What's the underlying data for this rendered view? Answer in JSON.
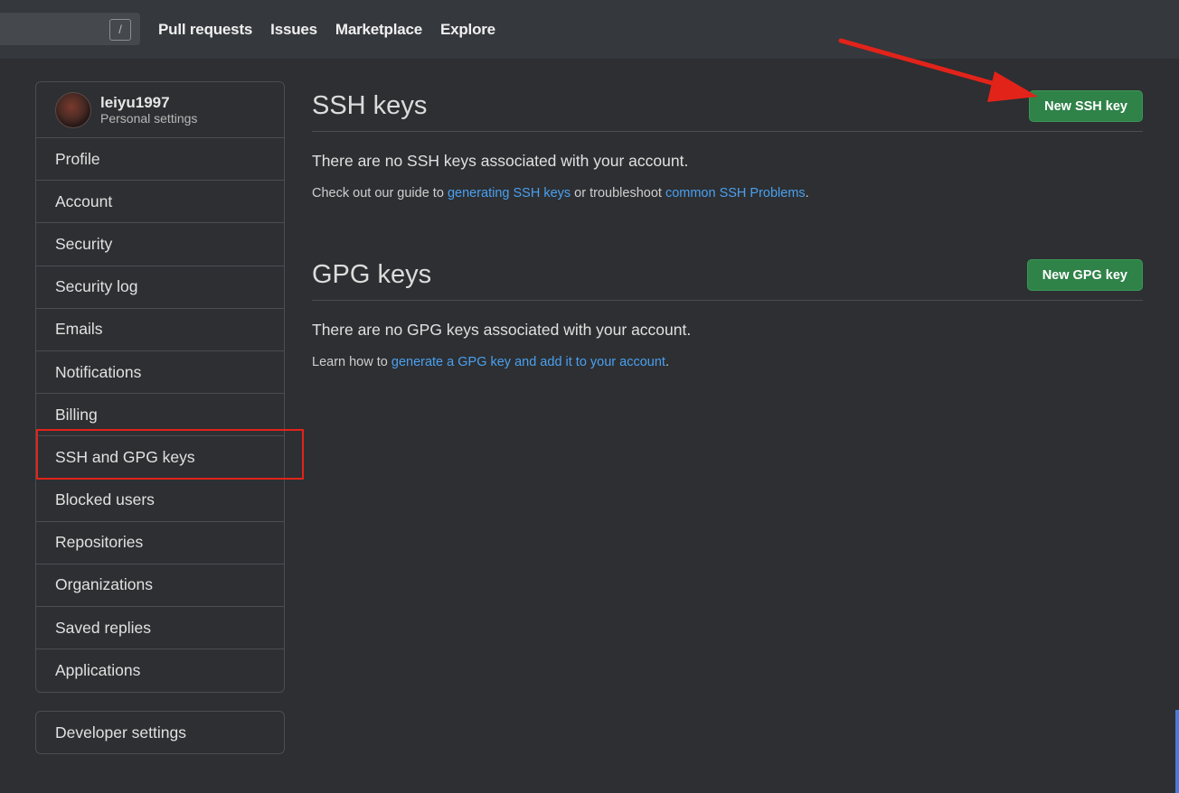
{
  "topbar": {
    "search_shortcut": "/",
    "nav": [
      "Pull requests",
      "Issues",
      "Marketplace",
      "Explore"
    ]
  },
  "sidebar": {
    "user": {
      "name": "leiyu1997",
      "subtitle": "Personal settings"
    },
    "items": [
      "Profile",
      "Account",
      "Security",
      "Security log",
      "Emails",
      "Notifications",
      "Billing",
      "SSH and GPG keys",
      "Blocked users",
      "Repositories",
      "Organizations",
      "Saved replies",
      "Applications"
    ],
    "selected": "SSH and GPG keys",
    "developer": "Developer settings"
  },
  "ssh": {
    "title": "SSH keys",
    "button": "New SSH key",
    "empty": "There are no SSH keys associated with your account.",
    "help_prefix": "Check out our guide to ",
    "help_link1": "generating SSH keys",
    "help_mid": " or troubleshoot ",
    "help_link2": "common SSH Problems",
    "help_suffix": "."
  },
  "gpg": {
    "title": "GPG keys",
    "button": "New GPG key",
    "empty": "There are no GPG keys associated with your account.",
    "help_prefix": "Learn how to ",
    "help_link": "generate a GPG key and add it to your account",
    "help_suffix": "."
  },
  "colors": {
    "accent_link": "#4aa0f0",
    "button_green": "#2f8248",
    "annotation_red": "#e2231a"
  }
}
